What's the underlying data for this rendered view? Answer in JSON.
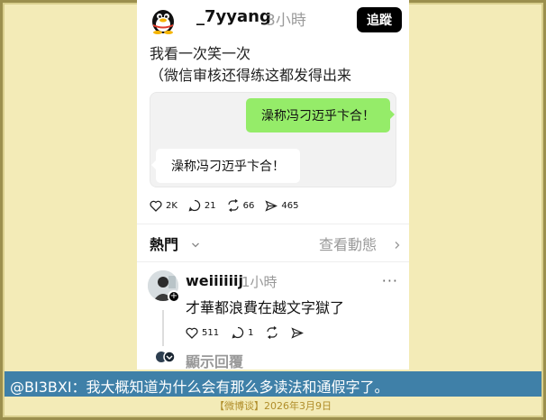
{
  "post": {
    "username": "_7yyang",
    "time": "3小時",
    "follow_label": "追蹤",
    "text": "我看一次笑一次\n（微信审核还得练这都发得出来",
    "chat": {
      "green_bubble": "澡称冯刁迈乎卞合！",
      "white_bubble": "澡称冯刁迈乎卞合！"
    },
    "actions": {
      "likes": "2K",
      "comments": "21",
      "reposts": "66",
      "shares": "465"
    }
  },
  "tabs": {
    "hot_label": "熱門",
    "view_activity_label": "查看動態"
  },
  "comment": {
    "username": "weiiiiiij",
    "time": "1小時",
    "more": "···",
    "text": "才華都浪費在越文字獄了",
    "likes": "511",
    "replies": "1",
    "show_replies": "顯示回覆"
  },
  "caption": {
    "text": "@BI3BXI：我大概知道为什么会有那么多读法和通假字了。"
  },
  "source": {
    "text": "【微博谈】2026年3月9日"
  },
  "colors": {
    "background": "#f3ebb7",
    "caption_bar": "#3f80a8",
    "wechat_green": "#95ec69"
  }
}
